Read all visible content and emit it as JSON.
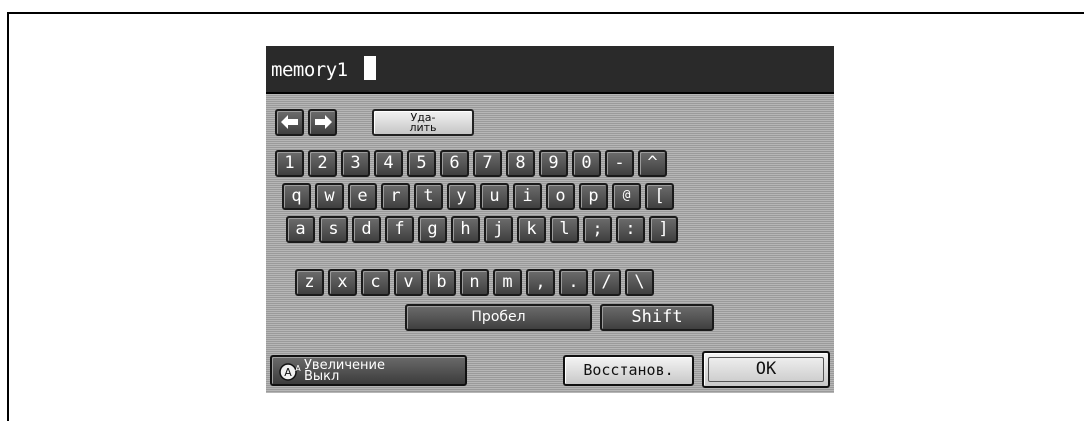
{
  "input": {
    "value": "memory1"
  },
  "nav": {
    "left_icon": "arrow-left-icon",
    "right_icon": "arrow-right-icon",
    "delete_line1": "Уда-",
    "delete_line2": "лить"
  },
  "keyboard": {
    "row1": [
      "1",
      "2",
      "3",
      "4",
      "5",
      "6",
      "7",
      "8",
      "9",
      "0",
      "-",
      "^"
    ],
    "row2": [
      "q",
      "w",
      "e",
      "r",
      "t",
      "y",
      "u",
      "i",
      "o",
      "p",
      "@",
      "["
    ],
    "row3": [
      "a",
      "s",
      "d",
      "f",
      "g",
      "h",
      "j",
      "k",
      "l",
      ";",
      ":",
      "]"
    ],
    "row4": [
      "z",
      "x",
      "c",
      "v",
      "b",
      "n",
      "m",
      ",",
      ".",
      "/",
      "\\"
    ],
    "space_label": "Пробел",
    "shift_label": "Shift"
  },
  "bottom": {
    "zoom_icon": "zoom-icon",
    "zoom_line1": "Увеличение",
    "zoom_line2": "Выкл",
    "reset_label": "Восстанов.",
    "ok_label": "OK"
  }
}
